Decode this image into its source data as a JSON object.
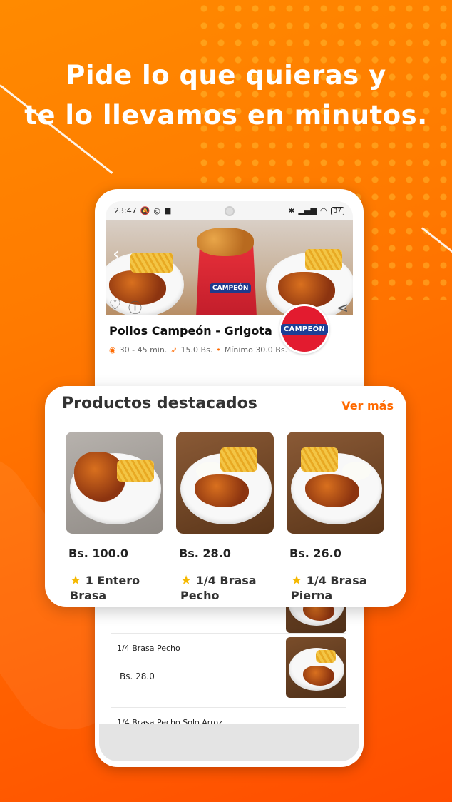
{
  "promo": {
    "line1": "Pide lo que quieras y",
    "line2": "te lo llevamos en minutos."
  },
  "status_bar": {
    "time": "23:47",
    "battery": "37"
  },
  "store": {
    "logo_text": "CAMPEÓN",
    "name": "Pollos Campeón - Grigota",
    "delivery_time": "30 - 45 min.",
    "delivery_fee": "15.0 Bs.",
    "minimum": "Mínimo 30.0 Bs."
  },
  "featured": {
    "title": "Productos destacados",
    "more_label": "Ver más",
    "items": [
      {
        "price": "Bs. 100.0",
        "name": "1 Entero Brasa"
      },
      {
        "price": "Bs. 28.0",
        "name": "1/4 Brasa Pecho"
      },
      {
        "price": "Bs. 26.0",
        "name": "1/4 Brasa Pierna"
      }
    ]
  },
  "product_list": [
    {
      "title": "1/4 Brasa Pecho",
      "price": "Bs. 28.0"
    },
    {
      "title": "1/4 Brasa Pecho Solo Arroz"
    }
  ],
  "colors": {
    "accent": "#ff6a00",
    "brand_red": "#e31b2f",
    "brand_blue": "#1c3f96"
  },
  "icons": {
    "back": "chevron-left-icon",
    "favorite": "heart-outline-icon",
    "info": "info-circle-icon",
    "share": "share-icon",
    "star": "star-icon"
  }
}
